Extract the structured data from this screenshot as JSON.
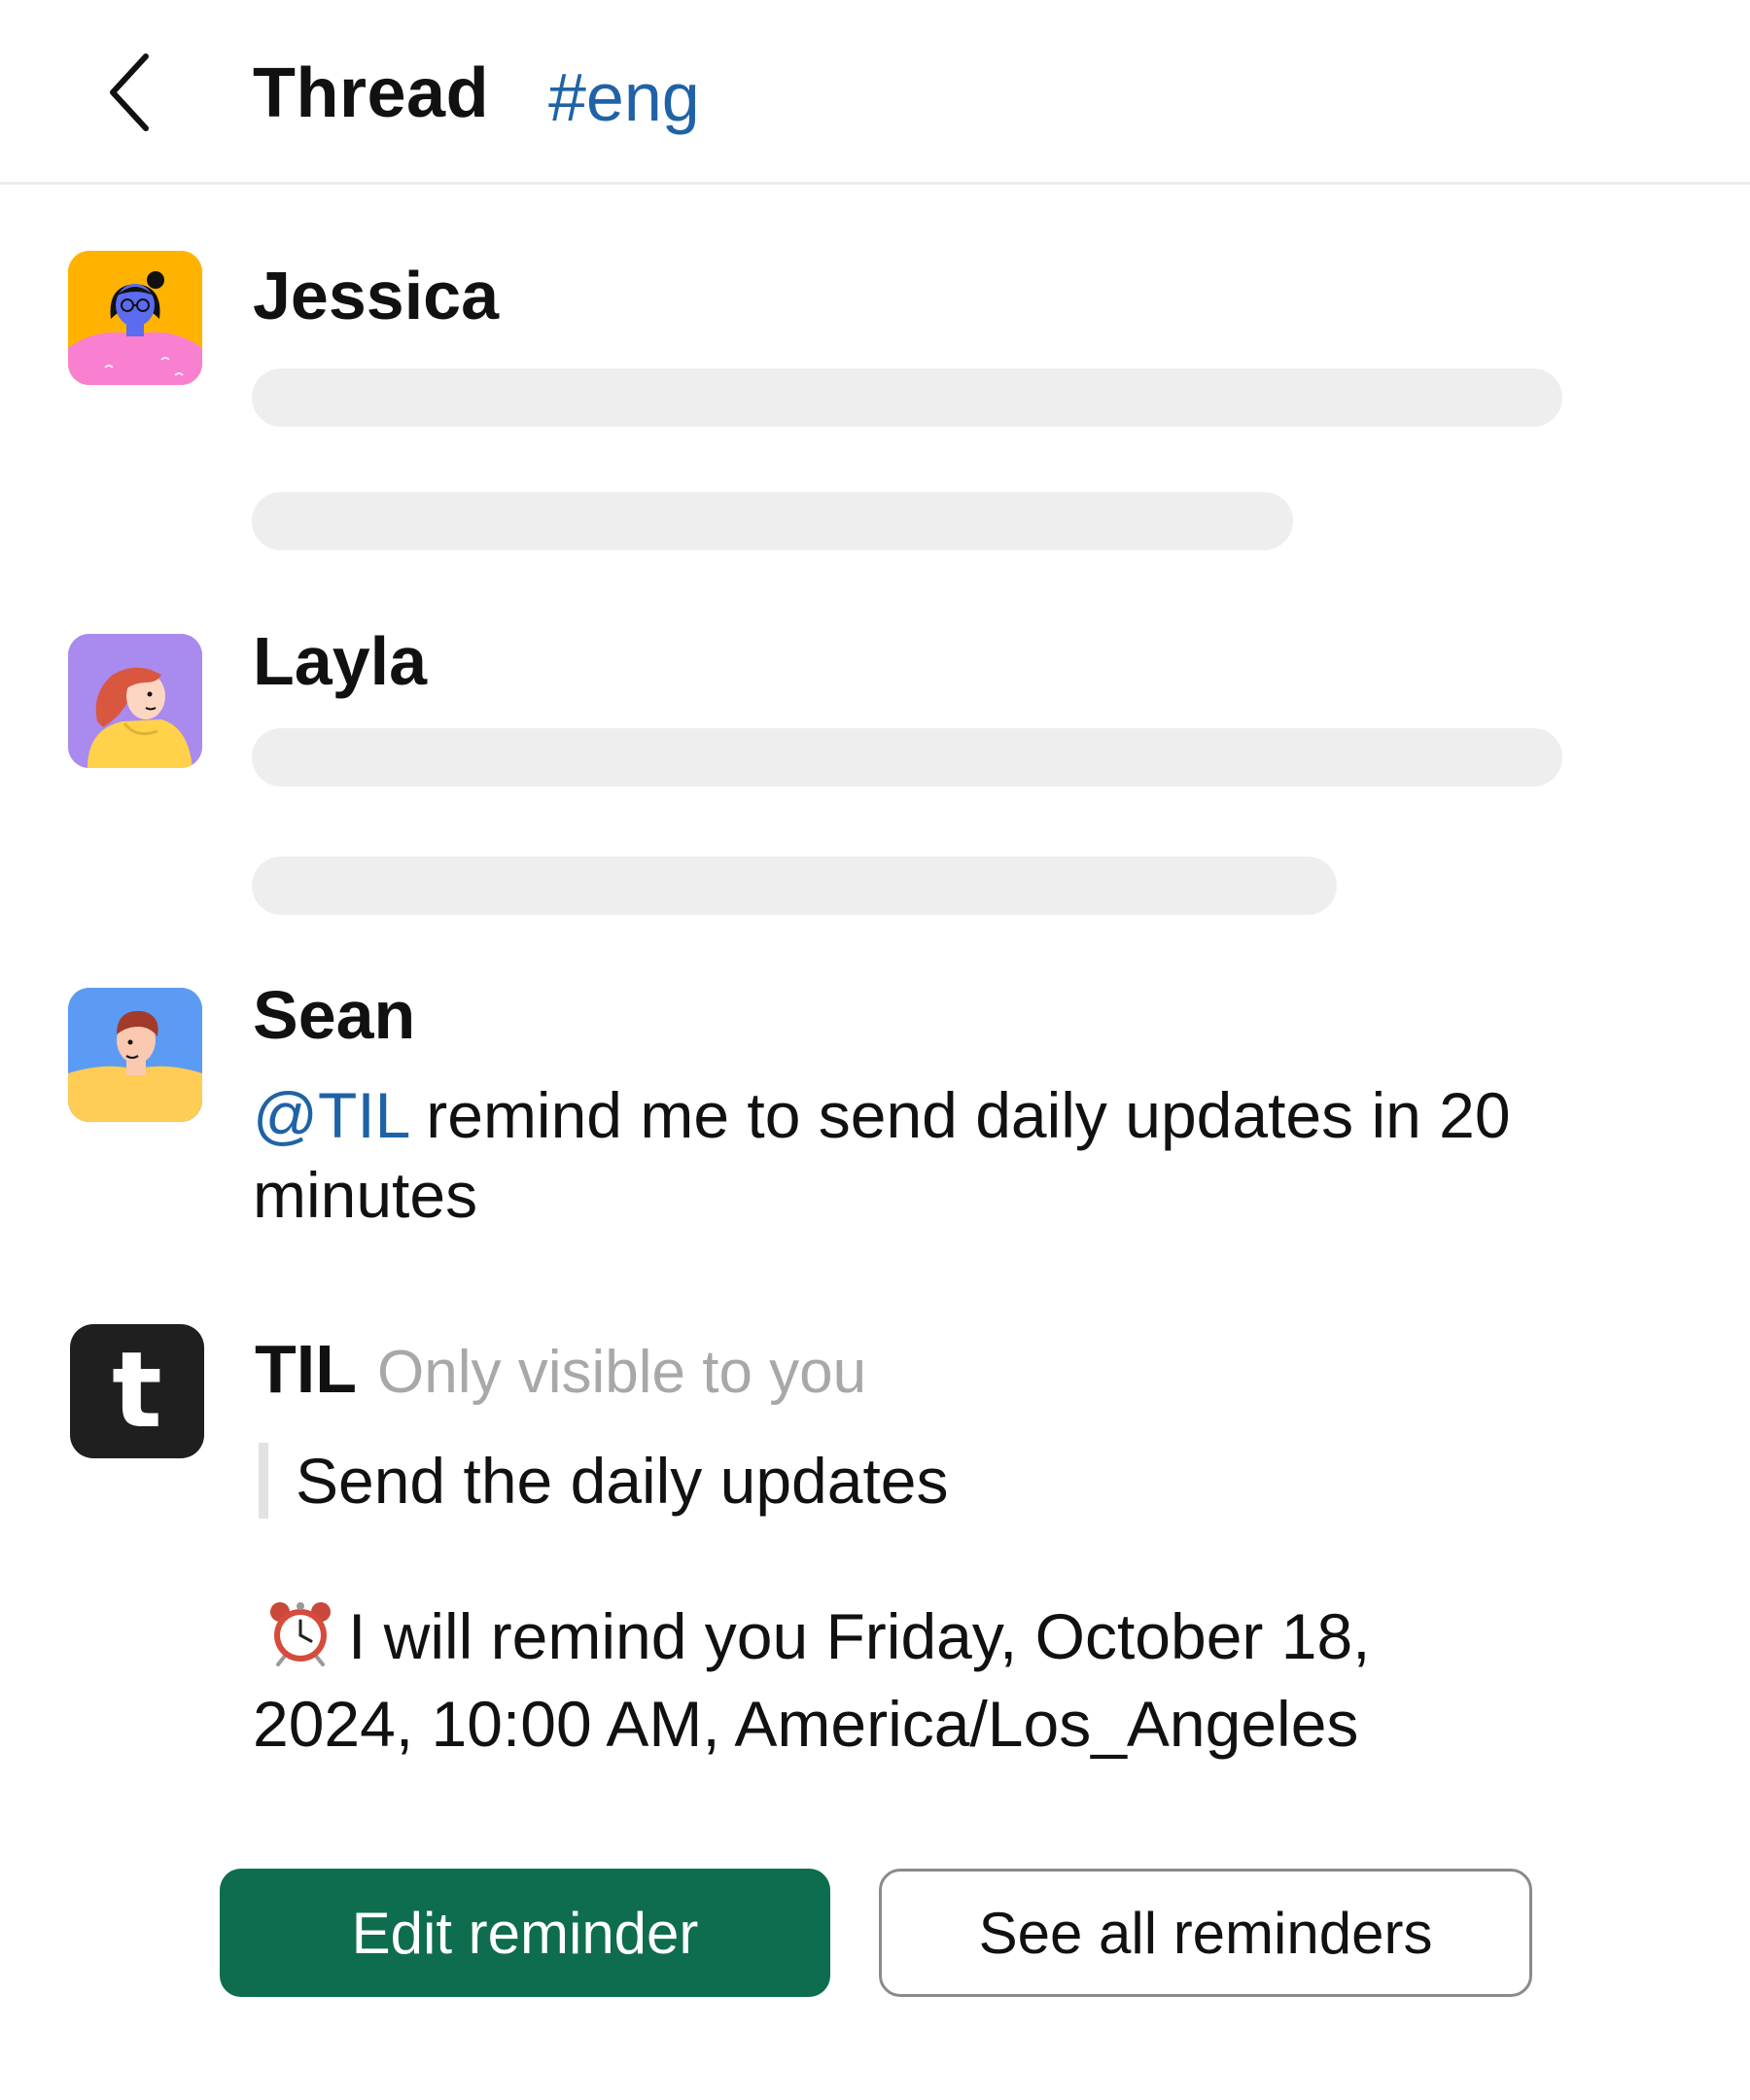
{
  "header": {
    "back_icon": "chevron-left-icon",
    "title": "Thread",
    "channel": "#eng"
  },
  "messages": [
    {
      "author": "Jessica",
      "avatar_color": "#ffb300",
      "content_state": "loading"
    },
    {
      "author": "Layla",
      "avatar_color": "#a98aee",
      "content_state": "loading"
    },
    {
      "author": "Sean",
      "avatar_color": "#5b9bf3",
      "mention": "@TIL",
      "text": " remind me to send daily updates in 20 minutes"
    },
    {
      "author": "TIL",
      "logo_letter": "t",
      "visibility_note": "Only visible to you",
      "quote": "Send the daily updates",
      "reminder_icon": "alarm-clock-icon",
      "reminder_text": "I will remind you Friday, October 18, 2024, 10:00 AM, America/Los_Angeles"
    }
  ],
  "actions": {
    "edit_label": "Edit reminder",
    "see_all_label": "See all reminders"
  },
  "colors": {
    "accent_link": "#1f63a6",
    "primary_button": "#0e6d4e",
    "skeleton": "#eeeeee",
    "muted_text": "#a8a8a8"
  }
}
